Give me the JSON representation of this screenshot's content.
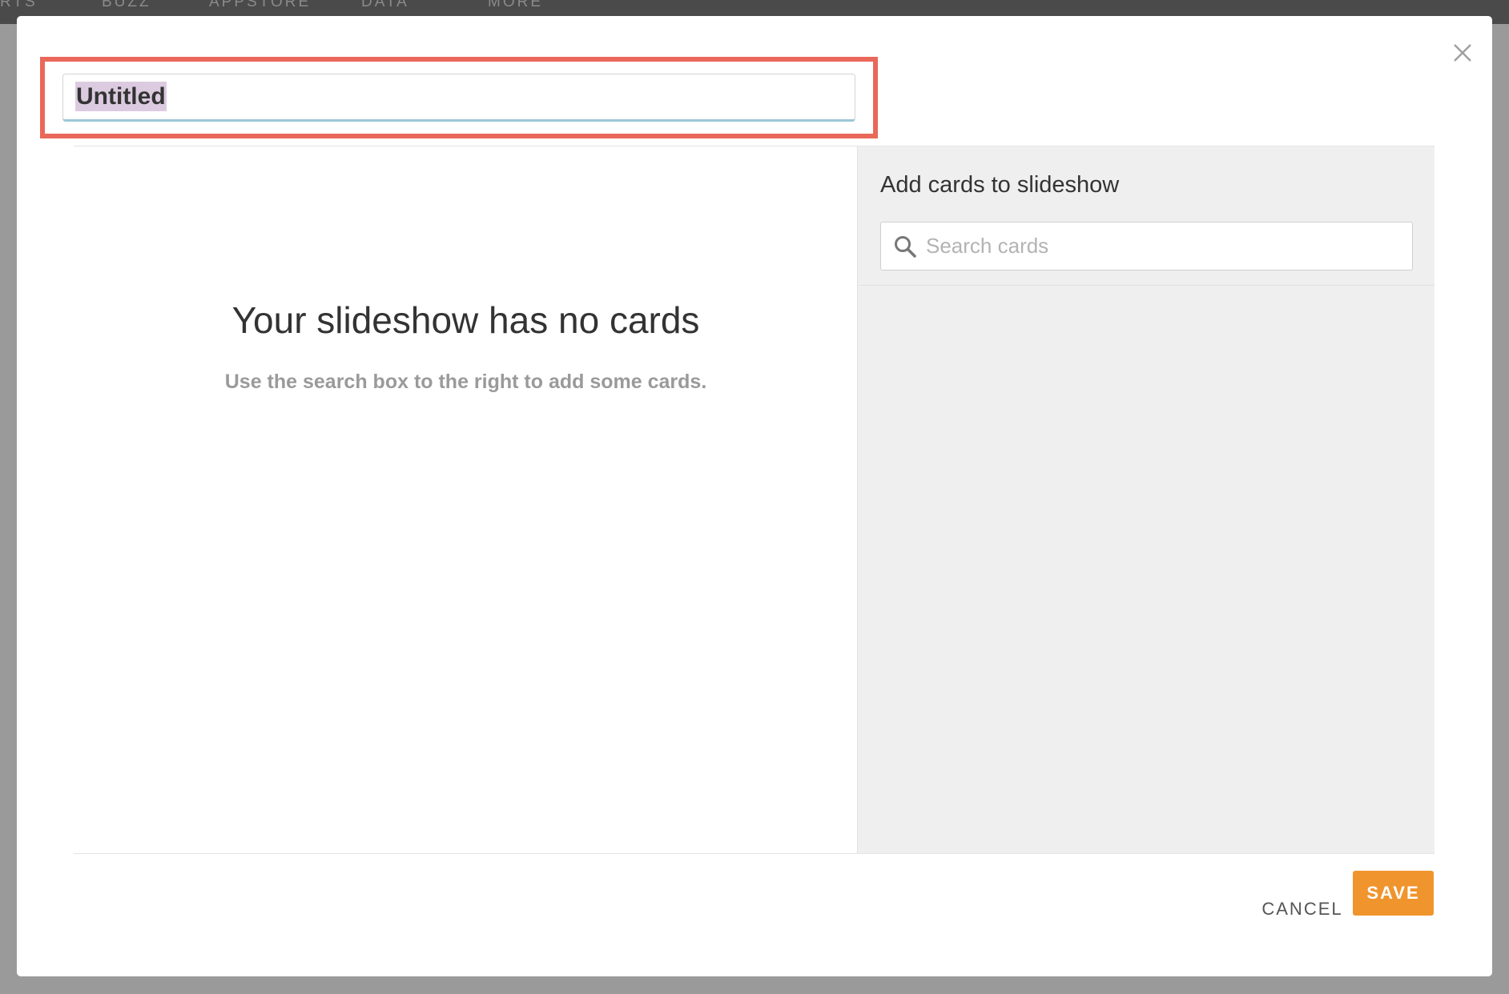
{
  "background_nav": {
    "items": [
      "RTS",
      "BUZZ",
      "APPSTORE",
      "DATA",
      "MORE"
    ]
  },
  "modal": {
    "title_value": "Untitled",
    "empty_state": {
      "heading": "Your slideshow has no cards",
      "subtext": "Use the search box to the right to add some cards."
    },
    "sidebar": {
      "title": "Add cards to slideshow",
      "search_placeholder": "Search cards"
    },
    "footer": {
      "cancel_label": "CANCEL",
      "save_label": "SAVE"
    }
  },
  "colors": {
    "accent_save": "#f0952d",
    "highlight_border": "#e9685a",
    "selection": "#dccbe0"
  },
  "icons": {
    "close": "close-icon",
    "search": "search-icon"
  }
}
